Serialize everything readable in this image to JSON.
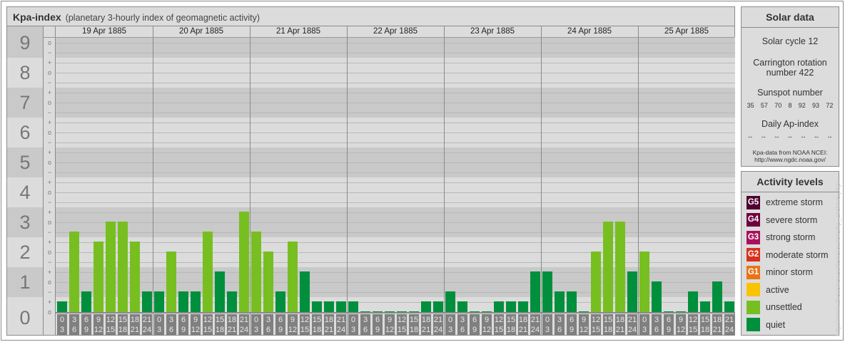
{
  "title": {
    "main": "Kpa-index",
    "sub": "(planetary 3-hourly index of geomagnetic activity)"
  },
  "chart_data": {
    "type": "bar",
    "title": "Kpa-index",
    "subtitle": "(planetary 3-hourly index of geomagnetic activity)",
    "y_labels": [
      "0",
      "1",
      "2",
      "3",
      "4",
      "5",
      "6",
      "7",
      "8",
      "9"
    ],
    "sub_labels": {
      "minus": "−",
      "zero": "o",
      "plus": "+"
    },
    "ylim": [
      "0o",
      "9o"
    ],
    "days": [
      "19 Apr 1885",
      "20 Apr 1885",
      "21 Apr 1885",
      "22 Apr 1885",
      "23 Apr 1885",
      "24 Apr 1885",
      "25 Apr 1885"
    ],
    "hours": [
      [
        "0",
        "3"
      ],
      [
        "3",
        "6"
      ],
      [
        "6",
        "9"
      ],
      [
        "9",
        "12"
      ],
      [
        "12",
        "15"
      ],
      [
        "15",
        "18"
      ],
      [
        "18",
        "21"
      ],
      [
        "21",
        "24"
      ]
    ],
    "series": [
      {
        "day": "19 Apr 1885",
        "values": [
          "0+",
          "3-",
          "1-",
          "2+",
          "3o",
          "3o",
          "2+",
          "1-"
        ]
      },
      {
        "day": "20 Apr 1885",
        "values": [
          "1-",
          "2o",
          "1-",
          "1-",
          "3-",
          "1+",
          "1-",
          "3+"
        ]
      },
      {
        "day": "21 Apr 1885",
        "values": [
          "3-",
          "2o",
          "1-",
          "2+",
          "1+",
          "0+",
          "0+",
          "0+"
        ]
      },
      {
        "day": "22 Apr 1885",
        "values": [
          "0+",
          "0o",
          "0o",
          "0o",
          "0o",
          "0o",
          "0+",
          "0+"
        ]
      },
      {
        "day": "23 Apr 1885",
        "values": [
          "1-",
          "0+",
          "0o",
          "0o",
          "0+",
          "0+",
          "0+",
          "1+"
        ]
      },
      {
        "day": "24 Apr 1885",
        "values": [
          "1+",
          "1-",
          "1-",
          "0o",
          "2o",
          "3o",
          "3o",
          "1+"
        ]
      },
      {
        "day": "25 Apr 1885",
        "values": [
          "2o",
          "1o",
          "0o",
          "0o",
          "1-",
          "0+",
          "1o",
          "0+"
        ]
      }
    ],
    "colors": {
      "quiet": "#008f3c",
      "unsettled": "#77bf20"
    }
  },
  "solar": {
    "header": "Solar data",
    "cycle": "Solar cycle 12",
    "carrington_1": "Carrington rotation",
    "carrington_2": "number 422",
    "sunspot_label": "Sunspot number",
    "sunspots": [
      "35",
      "57",
      "70",
      "8",
      "92",
      "93",
      "72"
    ],
    "ap_label": "Daily Ap-index",
    "ap": [
      "--",
      "--",
      "--",
      "--",
      "--",
      "--",
      "--"
    ],
    "source_1": "Kpa-data from NOAA NCEI:",
    "source_2": "http://www.ngdc.noaa.gov/"
  },
  "levels": {
    "header": "Activity levels",
    "items": [
      {
        "badge": "G5",
        "label": "extreme storm",
        "color": "#4f0030"
      },
      {
        "badge": "G4",
        "label": "severe storm",
        "color": "#6e0040"
      },
      {
        "badge": "G3",
        "label": "strong storm",
        "color": "#a8105e"
      },
      {
        "badge": "G2",
        "label": "moderate storm",
        "color": "#d8301c"
      },
      {
        "badge": "G1",
        "label": "minor storm",
        "color": "#e8741a"
      },
      {
        "badge": "",
        "label": "active",
        "color": "#f8c400"
      },
      {
        "badge": "",
        "label": "unsettled",
        "color": "#77bf20"
      },
      {
        "badge": "",
        "label": "quiet",
        "color": "#008f3c"
      }
    ]
  },
  "credit": "http://www.theusner.eu/terra/aurora/kp_archive.php"
}
